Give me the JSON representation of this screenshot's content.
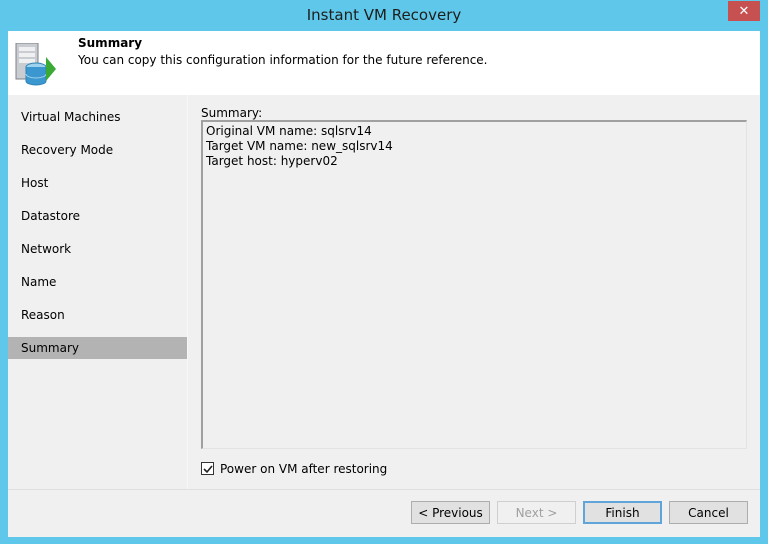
{
  "window": {
    "title": "Instant VM Recovery",
    "close_glyph": "✕"
  },
  "header": {
    "title": "Summary",
    "description": "You can copy this configuration information for the future reference.",
    "icon": "server-database-arrow-icon"
  },
  "sidebar": {
    "items": [
      {
        "label": "Virtual Machines",
        "active": false
      },
      {
        "label": "Recovery Mode",
        "active": false
      },
      {
        "label": "Host",
        "active": false
      },
      {
        "label": "Datastore",
        "active": false
      },
      {
        "label": "Network",
        "active": false
      },
      {
        "label": "Name",
        "active": false
      },
      {
        "label": "Reason",
        "active": false
      },
      {
        "label": "Summary",
        "active": true
      }
    ]
  },
  "main": {
    "summary_label": "Summary:",
    "summary_lines": [
      "Original VM name: sqlsrv14",
      "Target VM name: new_sqlsrv14",
      "Target host: hyperv02"
    ],
    "power_on_checkbox": {
      "label": "Power on VM after restoring",
      "checked": true
    }
  },
  "footer": {
    "previous_label": "< Previous",
    "next_label": "Next >",
    "finish_label": "Finish",
    "cancel_label": "Cancel"
  },
  "colors": {
    "title_bar": "#5fc8ea",
    "close_button": "#c75050",
    "active_step": "#b3b3b3",
    "default_button_border": "#5fa5d9",
    "icon_green": "#3aaa35"
  }
}
